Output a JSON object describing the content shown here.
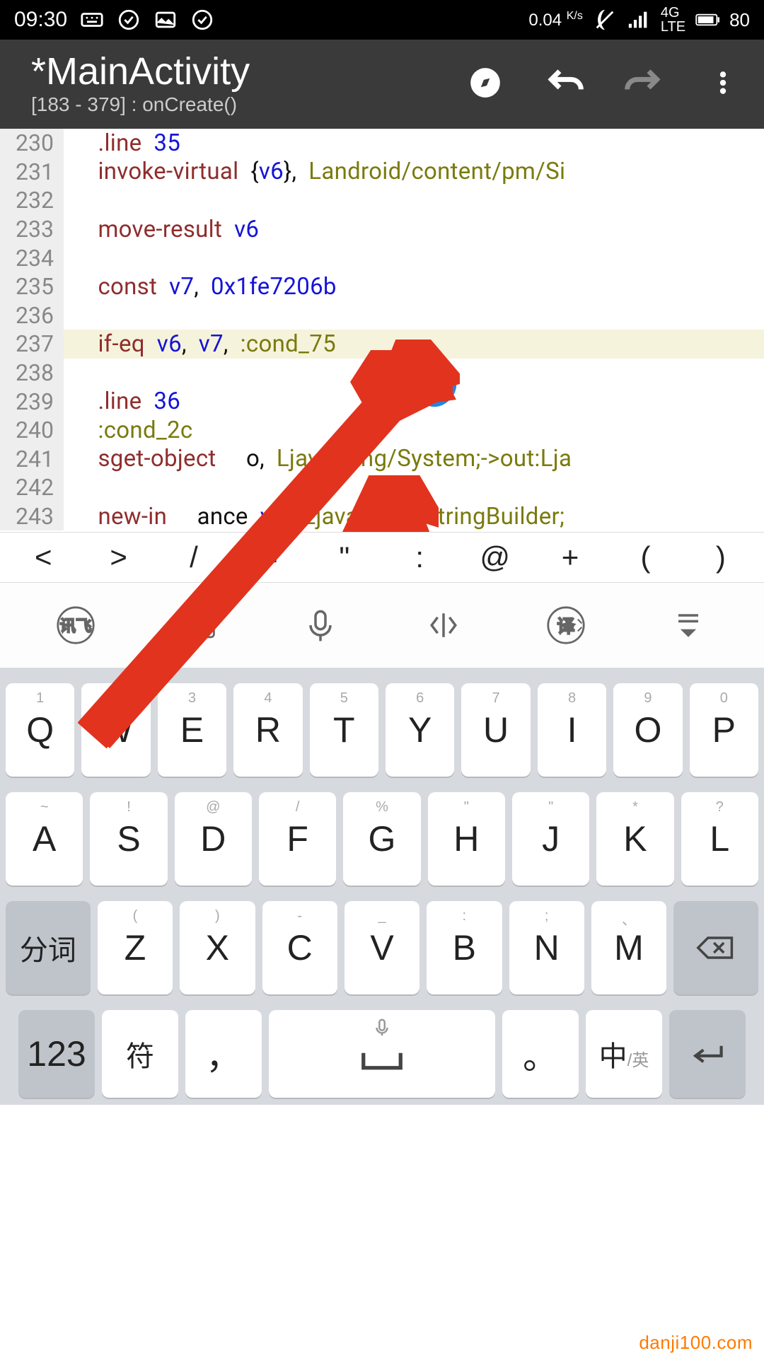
{
  "status": {
    "time": "09:30",
    "speed": "0.04",
    "speed_unit": "K/s",
    "net": "4G LTE",
    "battery": "80"
  },
  "appbar": {
    "title": "*MainActivity",
    "subtitle": "[183 - 379] : onCreate()"
  },
  "lines": [
    {
      "num": "230",
      "tokens": [
        {
          "t": "kw",
          "s": ".line"
        },
        {
          "t": "txt",
          "s": "  "
        },
        {
          "t": "lit",
          "s": "35"
        }
      ]
    },
    {
      "num": "231",
      "tokens": [
        {
          "t": "kw",
          "s": "invoke-virtual"
        },
        {
          "t": "txt",
          "s": "  {"
        },
        {
          "t": "reg",
          "s": "v6"
        },
        {
          "t": "txt",
          "s": "},  "
        },
        {
          "t": "cls",
          "s": "Landroid/content/pm/Si"
        }
      ]
    },
    {
      "num": "232",
      "tokens": []
    },
    {
      "num": "233",
      "tokens": [
        {
          "t": "kw",
          "s": "move-result"
        },
        {
          "t": "txt",
          "s": "  "
        },
        {
          "t": "reg",
          "s": "v6"
        }
      ]
    },
    {
      "num": "234",
      "tokens": []
    },
    {
      "num": "235",
      "tokens": [
        {
          "t": "kw",
          "s": "const"
        },
        {
          "t": "txt",
          "s": "  "
        },
        {
          "t": "reg",
          "s": "v7"
        },
        {
          "t": "txt",
          "s": ",  "
        },
        {
          "t": "lit",
          "s": "0x1fe7206b"
        }
      ]
    },
    {
      "num": "236",
      "tokens": []
    },
    {
      "num": "237",
      "hl": true,
      "tokens": [
        {
          "t": "kw",
          "s": "if-eq"
        },
        {
          "t": "txt",
          "s": "  "
        },
        {
          "t": "reg",
          "s": "v6"
        },
        {
          "t": "txt",
          "s": ",  "
        },
        {
          "t": "reg",
          "s": "v7"
        },
        {
          "t": "txt",
          "s": ",  "
        },
        {
          "t": "lbl",
          "s": ":cond_75"
        }
      ]
    },
    {
      "num": "238",
      "tokens": []
    },
    {
      "num": "239",
      "tokens": [
        {
          "t": "kw",
          "s": ".line"
        },
        {
          "t": "txt",
          "s": "  "
        },
        {
          "t": "lit",
          "s": "36"
        }
      ]
    },
    {
      "num": "240",
      "tokens": [
        {
          "t": "lbl",
          "s": ":cond_2c"
        }
      ]
    },
    {
      "num": "241",
      "tokens": [
        {
          "t": "kw",
          "s": "sget-object"
        },
        {
          "t": "txt",
          "s": "     o,  "
        },
        {
          "t": "cls",
          "s": "Ljava/lang/System;->out:Lja"
        }
      ]
    },
    {
      "num": "242",
      "tokens": []
    },
    {
      "num": "243",
      "tokens": [
        {
          "t": "kw",
          "s": "new-in"
        },
        {
          "t": "txt",
          "s": "     ance  "
        },
        {
          "t": "reg",
          "s": "v7"
        },
        {
          "t": "txt",
          "s": "   "
        },
        {
          "t": "cls",
          "s": "Ljava/lang/StringBuilder;"
        }
      ]
    }
  ],
  "symrow": [
    "<",
    ">",
    "/",
    "=",
    "\"",
    ":",
    "@",
    "+",
    "(",
    ")"
  ],
  "kbd": {
    "r1": [
      {
        "mini": "1",
        "big": "Q"
      },
      {
        "mini": "2",
        "big": "W"
      },
      {
        "mini": "3",
        "big": "E"
      },
      {
        "mini": "4",
        "big": "R"
      },
      {
        "mini": "5",
        "big": "T"
      },
      {
        "mini": "6",
        "big": "Y"
      },
      {
        "mini": "7",
        "big": "U"
      },
      {
        "mini": "8",
        "big": "I"
      },
      {
        "mini": "9",
        "big": "O"
      },
      {
        "mini": "0",
        "big": "P"
      }
    ],
    "r2": [
      {
        "mini": "~",
        "big": "A"
      },
      {
        "mini": "!",
        "big": "S"
      },
      {
        "mini": "@",
        "big": "D"
      },
      {
        "mini": "/",
        "big": "F"
      },
      {
        "mini": "%",
        "big": "G"
      },
      {
        "mini": "\"",
        "big": "H"
      },
      {
        "mini": "\"",
        "big": "J"
      },
      {
        "mini": "*",
        "big": "K"
      },
      {
        "mini": "?",
        "big": "L"
      }
    ],
    "r3_fn_left": "分词",
    "r3": [
      {
        "mini": "(",
        "big": "Z"
      },
      {
        "mini": ")",
        "big": "X"
      },
      {
        "mini": "-",
        "big": "C"
      },
      {
        "mini": "_",
        "big": "V"
      },
      {
        "mini": ":",
        "big": "B"
      },
      {
        "mini": ";",
        "big": "N"
      },
      {
        "mini": "、",
        "big": "M"
      }
    ],
    "r4": {
      "num": "123",
      "sym": "符",
      "comma": "，",
      "period": "。",
      "lang": "中",
      "lang_sub": "/英"
    }
  },
  "watermark": "danji100.com"
}
